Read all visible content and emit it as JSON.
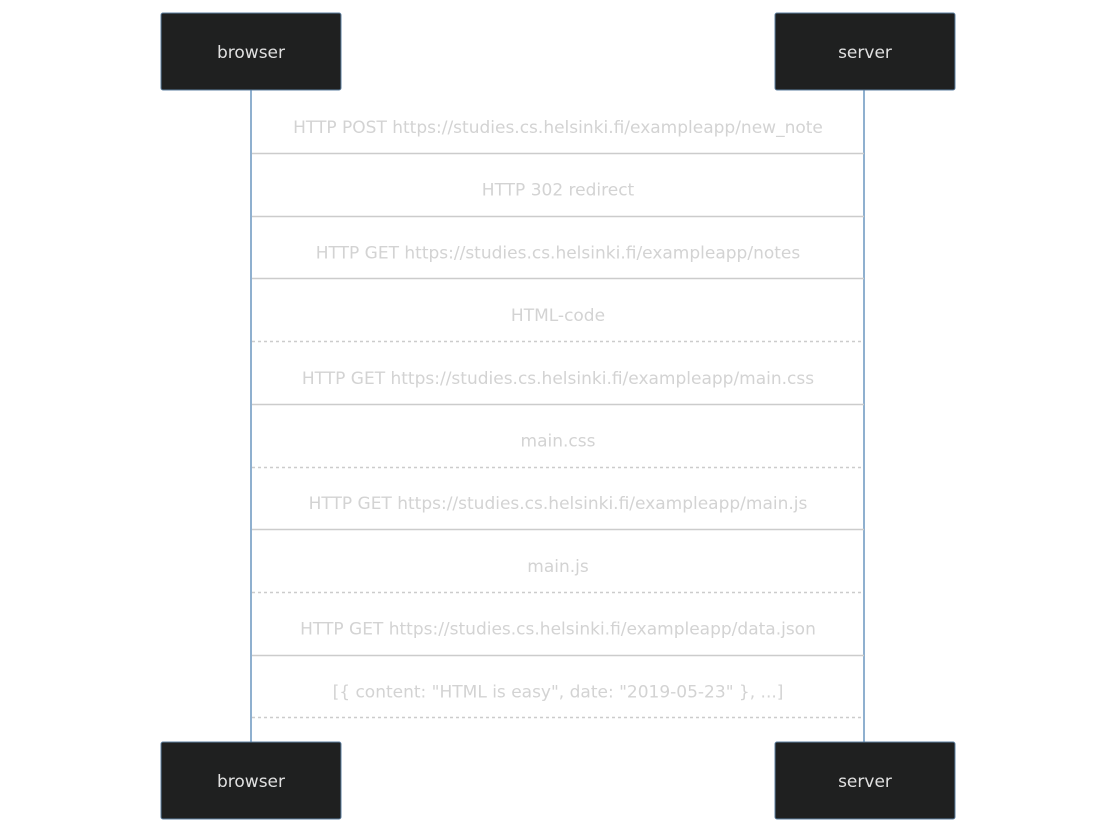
{
  "actors": {
    "browser": "browser",
    "server": "server"
  },
  "messages": [
    {
      "text": "HTTP POST https://studies.cs.helsinki.fi/exampleapp/new_note",
      "style": "solid"
    },
    {
      "text": "HTTP 302 redirect",
      "style": "solid"
    },
    {
      "text": "HTTP GET https://studies.cs.helsinki.fi/exampleapp/notes",
      "style": "solid"
    },
    {
      "text": "HTML-code",
      "style": "dashed"
    },
    {
      "text": "HTTP GET https://studies.cs.helsinki.fi/exampleapp/main.css",
      "style": "solid"
    },
    {
      "text": "main.css",
      "style": "dashed"
    },
    {
      "text": "HTTP GET https://studies.cs.helsinki.fi/exampleapp/main.js",
      "style": "solid"
    },
    {
      "text": "main.js",
      "style": "dashed"
    },
    {
      "text": "HTTP GET https://studies.cs.helsinki.fi/exampleapp/data.json",
      "style": "solid"
    },
    {
      "text": "[{ content: \"HTML is easy\", date: \"2019-05-23\" }, ...]",
      "style": "dashed"
    }
  ],
  "colors": {
    "actor_fill": "#1f2020",
    "lifeline": "#8fb0cf",
    "message_text": "#d3d3d3",
    "message_line": "#cccccc"
  }
}
